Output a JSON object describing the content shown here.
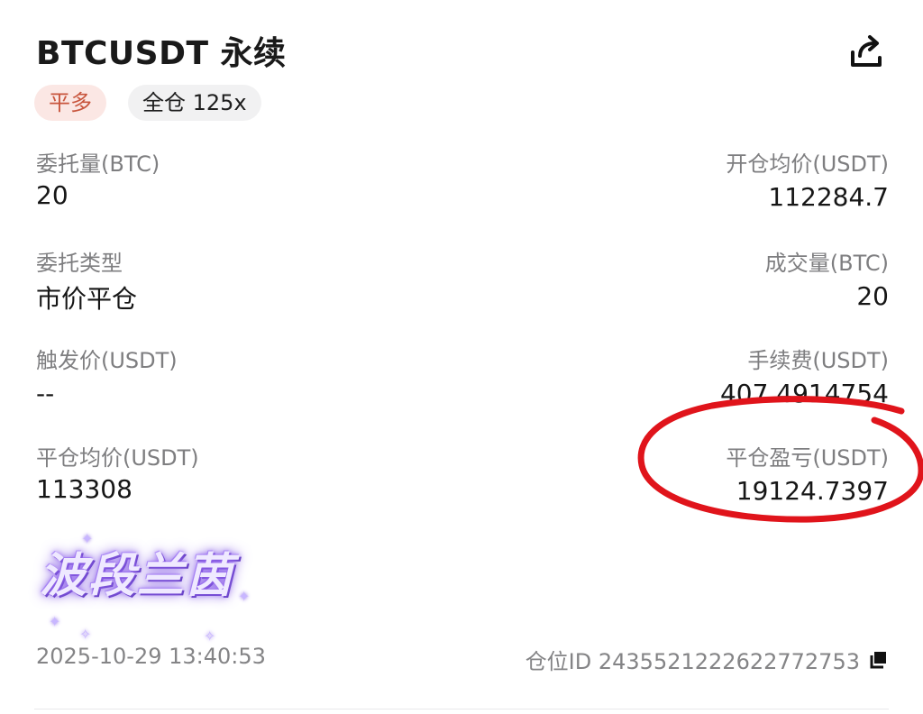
{
  "header": {
    "title": "BTCUSDT 永续",
    "share_icon": "share-icon"
  },
  "tags": {
    "side": "平多",
    "margin": "全仓 125x"
  },
  "fields": {
    "order_qty_label": "委托量(BTC)",
    "order_qty_value": "20",
    "open_avg_label": "开仓均价(USDT)",
    "open_avg_value": "112284.7",
    "order_type_label": "委托类型",
    "order_type_value": "市价平仓",
    "filled_qty_label": "成交量(BTC)",
    "filled_qty_value": "20",
    "trigger_label": "触发价(USDT)",
    "trigger_value": "--",
    "fee_label": "手续费(USDT)",
    "fee_value": "407.4914754",
    "close_avg_label": "平仓均价(USDT)",
    "close_avg_value": "113308",
    "pnl_label": "平仓盈亏(USDT)",
    "pnl_value": "19124.7397"
  },
  "footer": {
    "time": "2025-10-29 13:40:53",
    "position_id": "仓位ID 2435521222622772753",
    "copy_icon": "copy-icon"
  },
  "overlay": {
    "watermark_text": "波段兰茵",
    "highlight_color": "#e0141b"
  }
}
